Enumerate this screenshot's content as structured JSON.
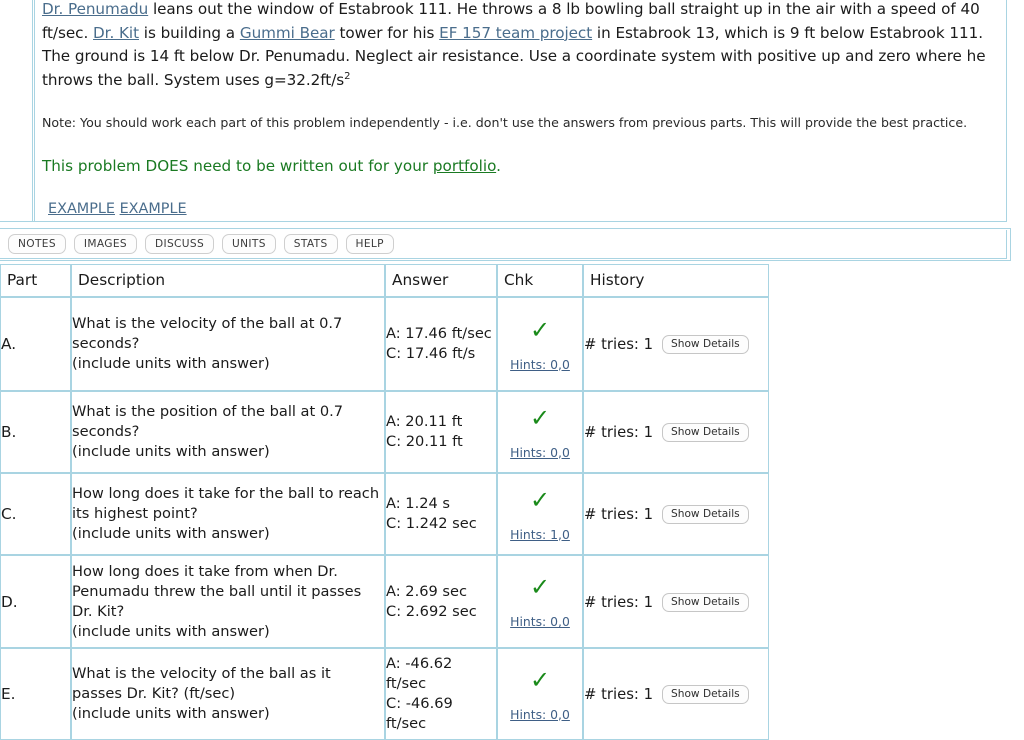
{
  "problem": {
    "statement_parts": [
      {
        "type": "link",
        "text": "Dr. Penumadu"
      },
      {
        "type": "text",
        "text": " leans out the window of Estabrook 111. He throws a 8 lb bowling ball straight up in the air with a speed of 40 ft/sec. "
      },
      {
        "type": "link",
        "text": "Dr. Kit"
      },
      {
        "type": "text",
        "text": " is building a "
      },
      {
        "type": "link",
        "text": "Gummi Bear"
      },
      {
        "type": "text",
        "text": " tower for his "
      },
      {
        "type": "link",
        "text": "EF 157 team project"
      },
      {
        "type": "text",
        "text": " in Estabrook 13, which is 9 ft below Estabrook 111. The ground is 14 ft below Dr. Penumadu. Neglect air resistance. Use a coordinate system with positive up and zero where he throws the ball. System uses g=32.2ft/s"
      },
      {
        "type": "sup",
        "text": "2"
      }
    ],
    "statement_lead_link": "Dr. Penumadu",
    "statement_seg_1": " leans out the window of Estabrook 111. He throws a 8 lb bowling ball straight up in the air with a speed of 40 ft/sec. ",
    "statement_link_2": "Dr. Kit",
    "statement_seg_2": " is building a ",
    "statement_link_3": "Gummi Bear",
    "statement_seg_3": " tower for his ",
    "statement_link_4": "EF 157 team project",
    "statement_seg_4": " in Estabrook 13, which is 9 ft below Estabrook 111. The ground is 14 ft below Dr. Penumadu. Neglect air resistance. Use a coordinate system with positive up and zero where he throws the ball. System uses g=32.2ft/s",
    "statement_exponent": "2",
    "note": "Note: You should work each part of this problem independently - i.e. don't use the answers from previous parts. This will provide the best practice.",
    "portfolio_prefix": "This problem DOES need to be written out for your ",
    "portfolio_link": "portfolio",
    "portfolio_suffix": ".",
    "example_link_1": "EXAMPLE",
    "example_link_2": "EXAMPLE",
    "green_color": "#1a7a22",
    "link_color": "#4a6d8c"
  },
  "toolbar": {
    "buttons": [
      {
        "label": "NOTES",
        "name": "notes-button"
      },
      {
        "label": "IMAGES",
        "name": "images-button"
      },
      {
        "label": "DISCUSS",
        "name": "discuss-button"
      },
      {
        "label": "UNITS",
        "name": "units-button"
      },
      {
        "label": "STATS",
        "name": "stats-button"
      },
      {
        "label": "HELP",
        "name": "help-button"
      }
    ]
  },
  "table": {
    "headers": {
      "part": "Part",
      "description": "Description",
      "answer": "Answer",
      "chk": "Chk",
      "history": "History"
    },
    "check_glyph": "✓",
    "details_label": "Show Details",
    "rows": [
      {
        "part": "A.",
        "description_line1": "What is the velocity of the ball at 0.7 seconds?",
        "description_line2": "(include units with answer)",
        "answer_line1": "A: 17.46 ft/sec",
        "answer_line2": "C: 17.46 ft/s",
        "hints": "Hints: 0,0",
        "tries": "# tries: 1",
        "details": "Show Details"
      },
      {
        "part": "B.",
        "description_line1": "What is the position of the ball at 0.7 seconds?",
        "description_line2": "(include units with answer)",
        "answer_line1": "A: 20.11 ft",
        "answer_line2": "C: 20.11 ft",
        "hints": "Hints: 0,0",
        "tries": "# tries: 1",
        "details": "Show Details"
      },
      {
        "part": "C.",
        "description_line1": "How long does it take for the ball to reach its highest point?",
        "description_line2": "(include units with answer)",
        "answer_line1": "A: 1.24 s",
        "answer_line2": "C: 1.242 sec",
        "hints": "Hints: 1,0",
        "tries": "# tries: 1",
        "details": "Show Details"
      },
      {
        "part": "D.",
        "description_line1": "How long does it take from when Dr. Penumadu threw the ball until it passes Dr. Kit?",
        "description_line2": "(include units with answer)",
        "answer_line1": "A: 2.69 sec",
        "answer_line2": "C: 2.692 sec",
        "hints": "Hints: 0,0",
        "tries": "# tries: 1",
        "details": "Show Details"
      },
      {
        "part": "E.",
        "description_line1": "What is the velocity of the ball as it passes Dr. Kit? (ft/sec)",
        "description_line2": "(include units with answer)",
        "answer_line1": "A: -46.62 ft/sec",
        "answer_line2": "C: -46.69 ft/sec",
        "hints": "Hints: 0,0",
        "tries": "# tries: 1",
        "details": "Show Details"
      }
    ]
  }
}
